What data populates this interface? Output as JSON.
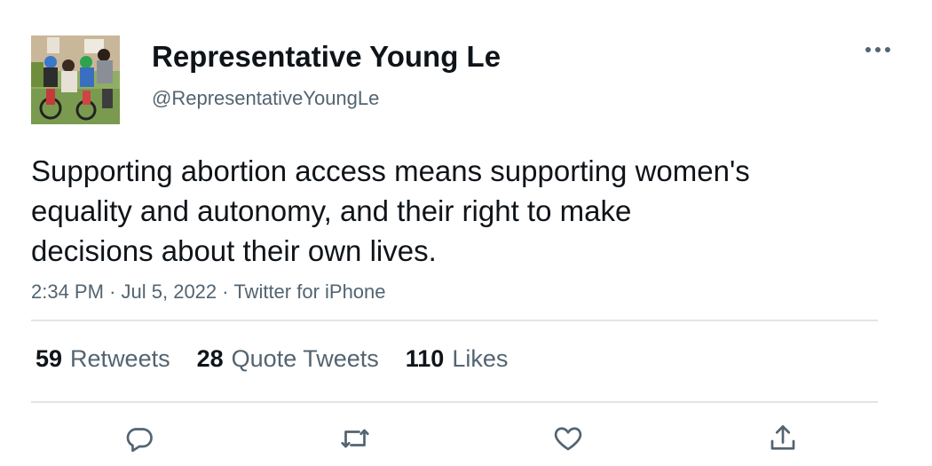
{
  "author": {
    "name": "Representative Young Le",
    "handle": "@RepresentativeYoungLe",
    "avatar_icon": "family-photo-avatar"
  },
  "tweet": {
    "text": "Supporting abortion access means supporting women's\nequality and autonomy, and their right to make\ndecisions about their own lives.",
    "time": "2:34 PM",
    "date": "Jul 5, 2022",
    "source": "Twitter for iPhone",
    "separator": "·"
  },
  "stats": {
    "retweets_count": "59",
    "retweets_label": "Retweets",
    "quotes_count": "28",
    "quotes_label": "Quote Tweets",
    "likes_count": "110",
    "likes_label": "Likes"
  },
  "actions": {
    "reply": "reply-icon",
    "retweet": "retweet-icon",
    "like": "heart-icon",
    "share": "share-icon"
  },
  "colors": {
    "text_primary": "#0f1419",
    "text_secondary": "#536471",
    "divider": "#e1e5e8"
  }
}
